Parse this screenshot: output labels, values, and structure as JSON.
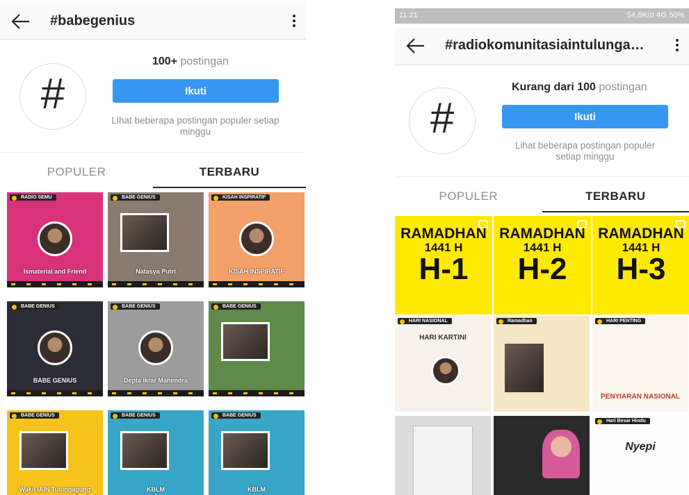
{
  "left": {
    "title": "#babegenius",
    "avatar_symbol": "#",
    "post_count_bold": "100+",
    "post_count_rest": " postingan",
    "follow_label": "Ikuti",
    "hint": "Lihat beberapa postingan populer setiap minggu",
    "tabs": [
      {
        "label": "POPULER"
      },
      {
        "label": "TERBARU"
      }
    ],
    "tiles": [
      {
        "badge": "RADIO SEMU",
        "caption": "Ismaterial and Friend",
        "bg": "#d8337a"
      },
      {
        "badge": "BABE GENIUS",
        "caption": "Natasya Putri",
        "bg": "#8a7b70"
      },
      {
        "badge": "KISAH INSPIRATIF",
        "caption": "KISAH INSPIRATIF",
        "bg": "#f3a06a"
      },
      {
        "badge": "BABE GENIUS",
        "caption": "BABE GENIUS",
        "bg": "#2d2d38"
      },
      {
        "badge": "BABE GENIUS",
        "caption": "Depta Ikrar Mahendra",
        "bg": "#9c9c9c"
      },
      {
        "badge": "BABE GENIUS",
        "caption": "",
        "bg": "#5f8a4a"
      },
      {
        "badge": "BABE GENIUS",
        "caption": "Wakil IAIN Tulungagung",
        "bg": "#f6c21c"
      },
      {
        "badge": "BABE GENIUS",
        "caption": "KBLM",
        "bg": "#39a6c8"
      },
      {
        "badge": "BABE GENIUS",
        "caption": "KBLM",
        "bg": "#39a6c8"
      }
    ]
  },
  "right": {
    "status_time": "11:21",
    "status_net": "54,6K/d  4G  50%",
    "title": "#radiokomunitasiaintulunga…",
    "avatar_symbol": "#",
    "post_count_bold": "Kurang dari 100",
    "post_count_rest": " postingan",
    "follow_label": "Ikuti",
    "hint": "Lihat beberapa postingan populer setiap minggu",
    "tabs": [
      {
        "label": "POPULER"
      },
      {
        "label": "TERBARU"
      }
    ],
    "ramadhan": [
      {
        "line1": "RAMADHAN",
        "line2": "1441 H",
        "big": "H-1"
      },
      {
        "line1": "RAMADHAN",
        "line2": "1441 H",
        "big": "H-2"
      },
      {
        "line1": "RAMADHAN",
        "line2": "1441 H",
        "big": "H-3"
      }
    ],
    "tiles": [
      {
        "badge": "HARI NASIONAL",
        "caption": "HARI KARTINI",
        "bg": "#f7f3ea"
      },
      {
        "badge": "Ramadhan",
        "caption": "",
        "bg": "#f5e7c4"
      },
      {
        "badge": "HARI PENTING",
        "caption": "PENYIARAN NASIONAL",
        "bg": "#fbf7ef"
      },
      {
        "badge": "",
        "caption": "",
        "bg": "#dcdcdc"
      },
      {
        "badge": "",
        "caption": "",
        "bg": "#2a2a2a"
      },
      {
        "badge": "Hari Besar Hindu",
        "caption": "Nyepi",
        "bg": "#fdfdfd"
      }
    ]
  },
  "colors": {
    "follow_blue": "#3897f0",
    "ramadhan_yellow": "#ffea00"
  }
}
